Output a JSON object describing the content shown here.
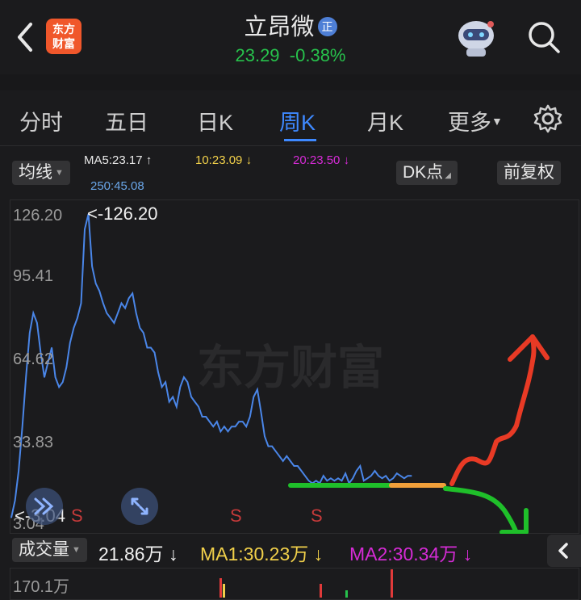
{
  "header": {
    "title": "立昂微",
    "badge": "正",
    "price": "23.29",
    "change": "-0.38%",
    "logo_line1": "东方",
    "logo_line2": "财富"
  },
  "tabs": [
    {
      "label": "分时"
    },
    {
      "label": "五日"
    },
    {
      "label": "日K"
    },
    {
      "label": "周K"
    },
    {
      "label": "月K"
    },
    {
      "label": "更多"
    }
  ],
  "active_tab": "周K",
  "indicators": {
    "ma_toggle": "均线",
    "ma5": "MA5:23.17",
    "ma10": "10:23.09",
    "ma20": "20:23.50",
    "ma250": "250:45.08",
    "dk_button": "DK点",
    "adjust_button": "前复权"
  },
  "chart": {
    "y_labels": [
      "126.20",
      "95.41",
      "64.62",
      "33.83",
      "3.04"
    ],
    "max_marker": "<-126.20",
    "min_marker": "<-3.04",
    "watermark": "东方财富",
    "s_markers": [
      "S",
      "S",
      "S"
    ]
  },
  "volume": {
    "toggle": "成交量",
    "value": "21.86万",
    "ma1": "MA1:30.23万",
    "ma2": "MA2:30.34万",
    "y_label": "170.1万"
  },
  "chart_data": {
    "type": "line",
    "ylim": [
      3.04,
      126.2
    ],
    "y_ticks": [
      126.2,
      95.41,
      64.62,
      33.83,
      3.04
    ],
    "values": [
      3.04,
      10,
      22,
      40,
      60,
      78,
      86,
      82,
      70,
      60,
      66,
      72,
      60,
      56,
      58,
      64,
      74,
      80,
      84,
      90,
      120,
      126.2,
      105,
      98,
      95,
      90,
      86,
      84,
      82,
      86,
      90,
      88,
      92,
      94,
      86,
      80,
      78,
      72,
      72,
      70,
      62,
      56,
      58,
      50,
      52,
      48,
      56,
      60,
      58,
      52,
      50,
      48,
      44,
      44,
      42,
      40,
      42,
      38,
      40,
      38,
      40,
      40,
      42,
      42,
      40,
      44,
      52,
      55,
      46,
      36,
      32,
      32,
      30,
      28,
      26,
      28,
      26,
      24,
      24,
      22,
      20,
      18,
      17,
      18,
      17,
      20,
      18,
      19,
      18,
      19,
      18,
      21,
      17,
      19,
      22,
      24,
      18,
      19,
      20,
      22,
      20,
      19,
      20,
      18,
      19,
      21,
      20,
      19,
      20,
      20
    ],
    "colors": {
      "line": "#4a86e8",
      "up": "#e03a3a",
      "down": "#27c24c",
      "ma10": "#f1d04a",
      "ma20": "#d62bd6"
    }
  }
}
